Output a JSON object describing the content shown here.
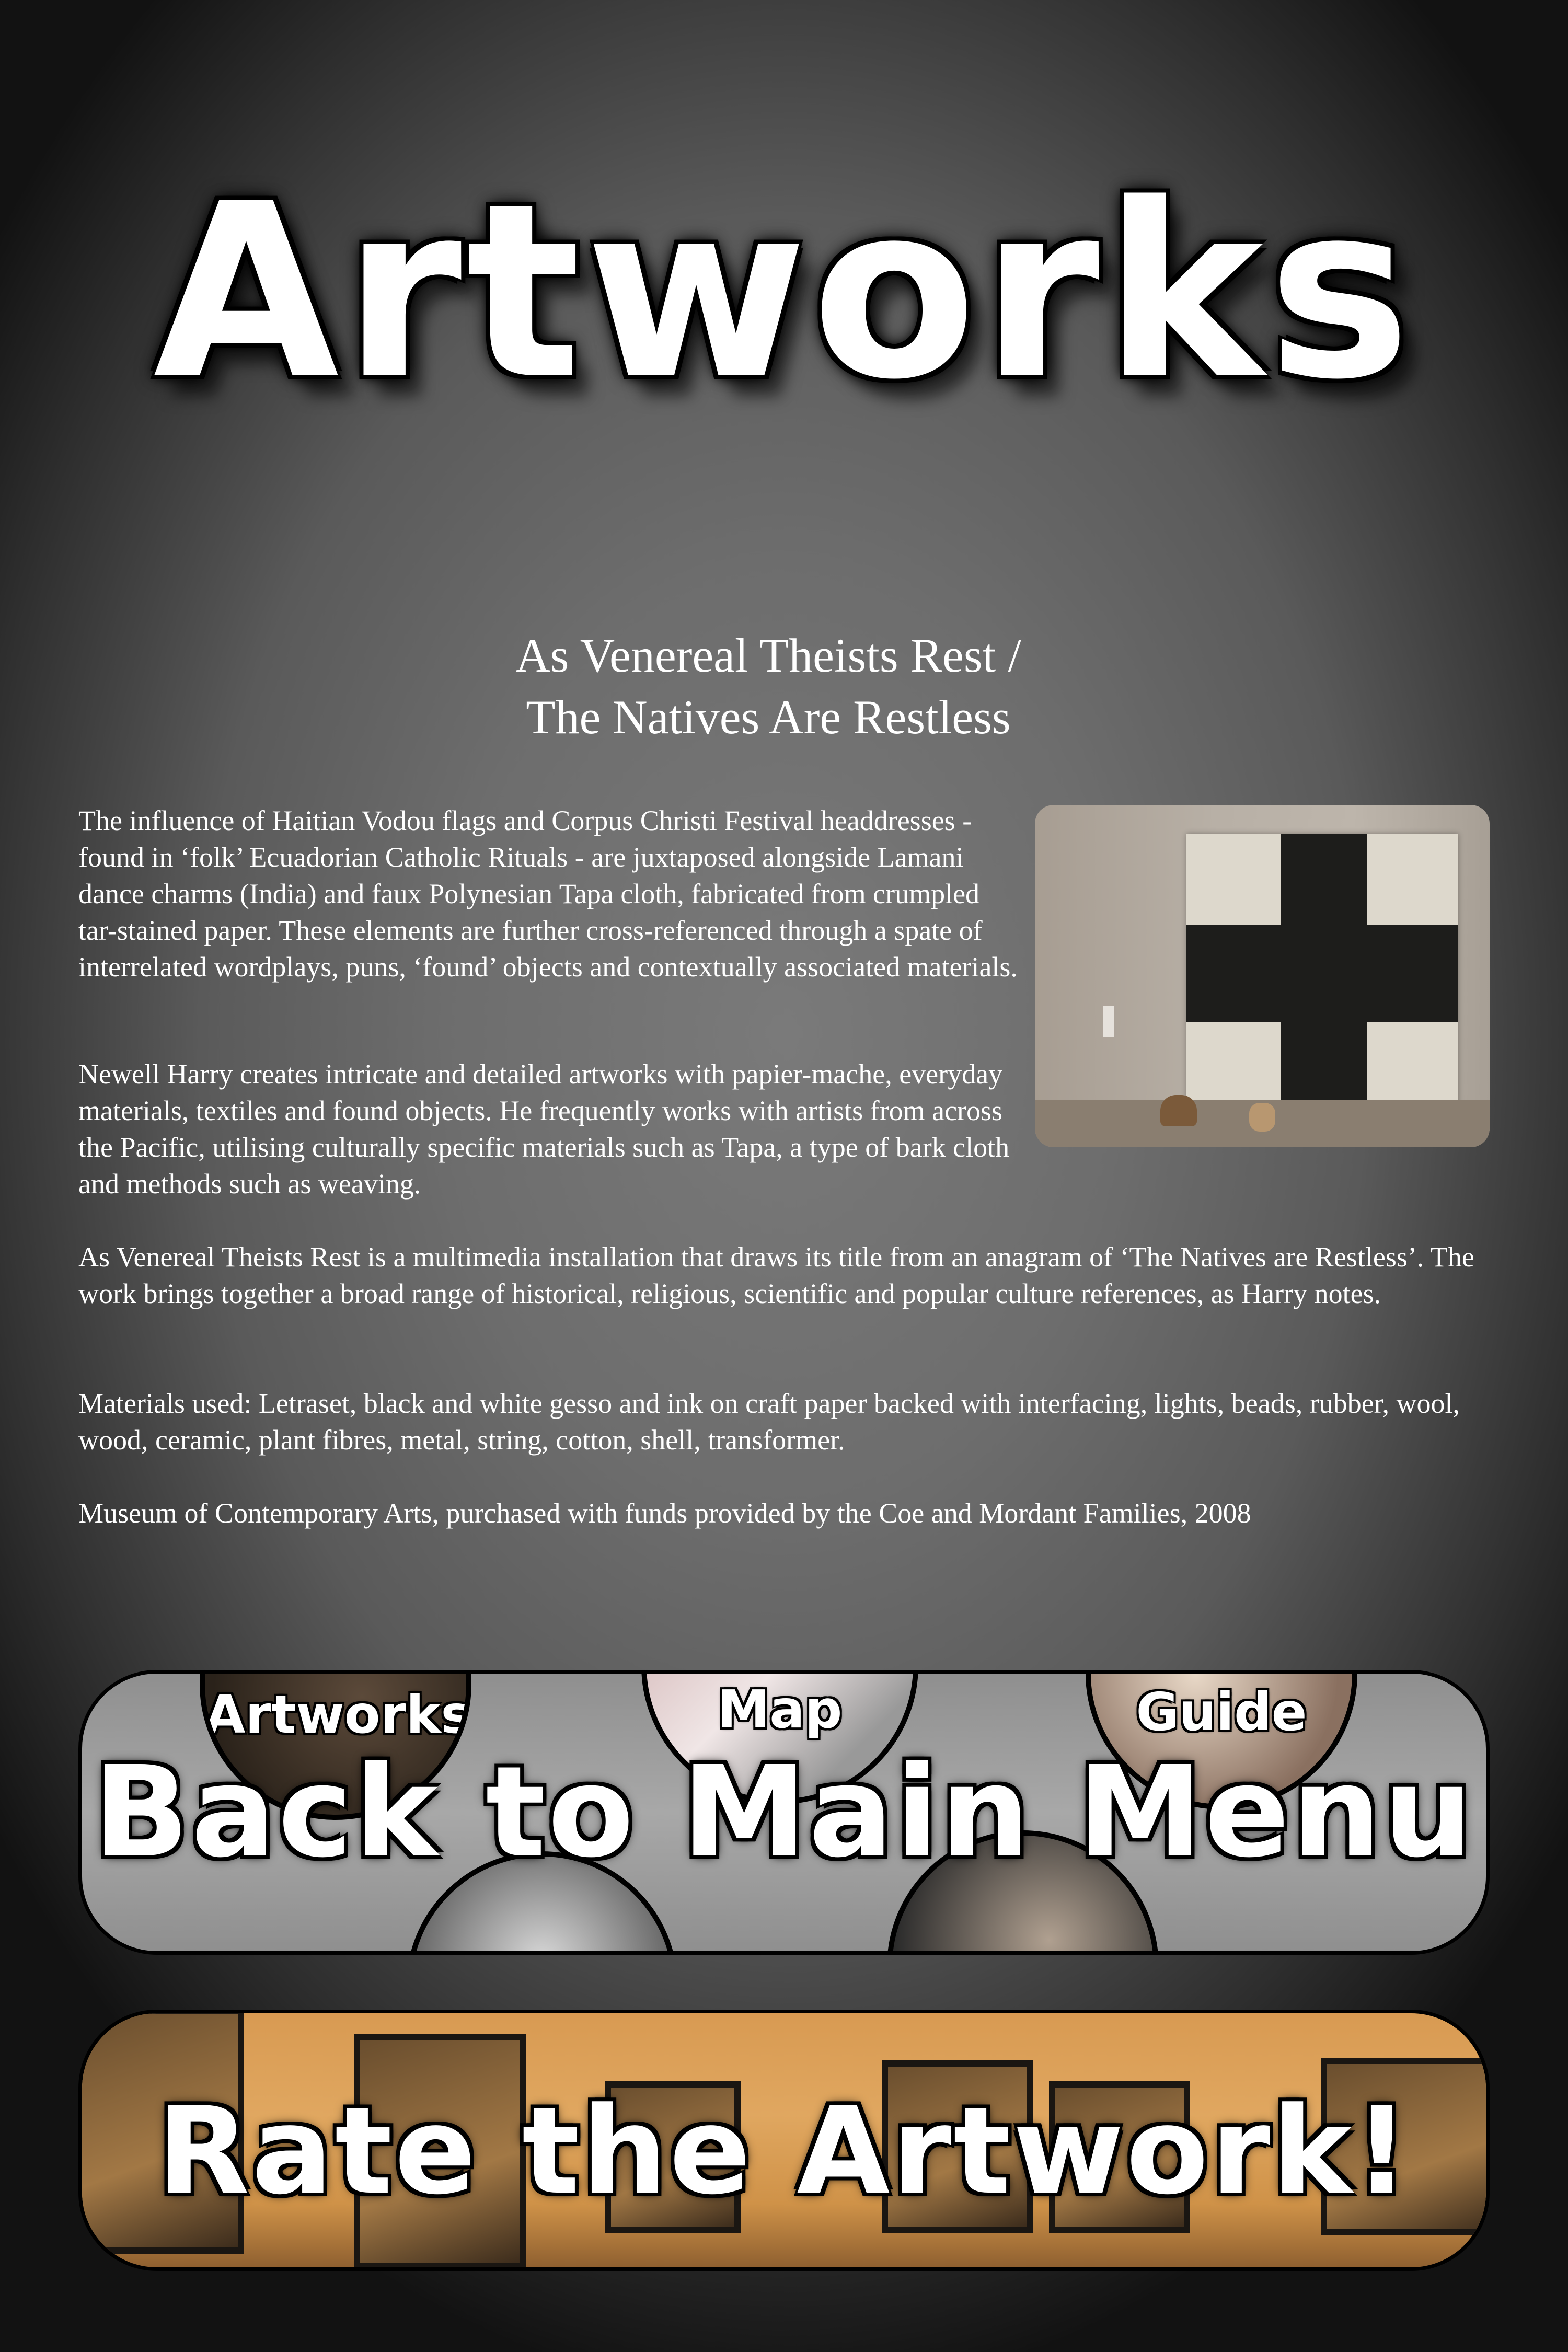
{
  "page": {
    "title": "Artworks"
  },
  "artwork": {
    "title_line1": "As Venereal Theists Rest /",
    "title_line2": "The Natives Are Restless",
    "paragraphs": [
      "The influence of Haitian Vodou flags and Corpus Christi Festival headdresses - found in ‘folk’ Ecuadorian Catholic Rituals - are juxtaposed alongside Lamani dance charms (India) and faux Polynesian Tapa cloth, fabricated from crumpled tar-stained paper. These elements are further cross-referenced through a spate of interrelated wordplays, puns, ‘found’ objects and contextually associated materials.",
      "Newell Harry creates intricate and detailed artworks with papier-mache, everyday materials, textiles and found objects. He frequently works with artists from across the Pacific, utilising culturally specific materials such as Tapa, a type of bark cloth and methods such as weaving.",
      "As Venereal Theists Rest is a multimedia installation that draws its title from an anagram of ‘The Natives are Restless’. The work brings together a broad range of historical, religious, scientific and popular culture references, as Harry notes.",
      "Materials used: Letraset, black and white gesso and ink on craft paper backed with interfacing, lights, beads, rubber, wool, wood, ceramic, plant fibres, metal, string, cotton, shell, transformer.",
      "Museum of Contemporary Arts, purchased with funds provided by the Coe and Mordant Families, 2008"
    ]
  },
  "buttons": {
    "main_menu": "Back to Main Menu",
    "main_menu_circles": [
      "Artworks",
      "Map",
      "Guide"
    ],
    "rate": "Rate the Artwork!"
  }
}
